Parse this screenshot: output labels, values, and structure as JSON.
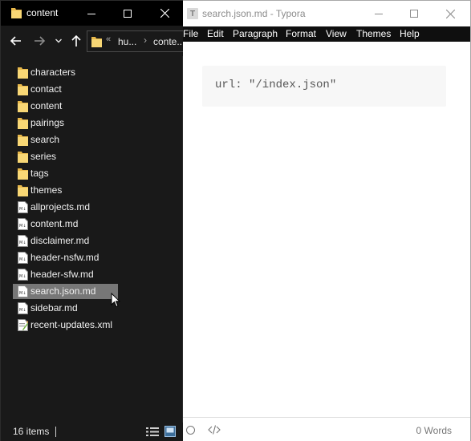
{
  "explorer": {
    "title": "content",
    "address": {
      "overflow": "«",
      "segments": [
        "hu...",
        "conte..."
      ],
      "separator": "›"
    },
    "items": [
      {
        "name": "characters",
        "type": "folder"
      },
      {
        "name": "contact",
        "type": "folder"
      },
      {
        "name": "content",
        "type": "folder"
      },
      {
        "name": "pairings",
        "type": "folder"
      },
      {
        "name": "search",
        "type": "folder"
      },
      {
        "name": "series",
        "type": "folder"
      },
      {
        "name": "tags",
        "type": "folder"
      },
      {
        "name": "themes",
        "type": "folder"
      },
      {
        "name": "allprojects.md",
        "type": "md"
      },
      {
        "name": "content.md",
        "type": "md"
      },
      {
        "name": "disclaimer.md",
        "type": "md"
      },
      {
        "name": "header-nsfw.md",
        "type": "md"
      },
      {
        "name": "header-sfw.md",
        "type": "md"
      },
      {
        "name": "search.json.md",
        "type": "md",
        "selected": true
      },
      {
        "name": "sidebar.md",
        "type": "md"
      },
      {
        "name": "recent-updates.xml",
        "type": "xml"
      }
    ],
    "status": {
      "count": "16 items"
    }
  },
  "typora": {
    "title": "search.json.md - Typora",
    "logo_letter": "T",
    "menu": [
      "File",
      "Edit",
      "Paragraph",
      "Format",
      "View",
      "Themes",
      "Help"
    ],
    "code": "url: \"/index.json\"",
    "word_count": "0 Words"
  },
  "colors": {
    "explorer_bg": "#191919",
    "folder_yellow": "#f8d775",
    "selection": "#777777",
    "typora_menubar": "#0f0f0f",
    "code_bg": "#f7f7f7"
  }
}
